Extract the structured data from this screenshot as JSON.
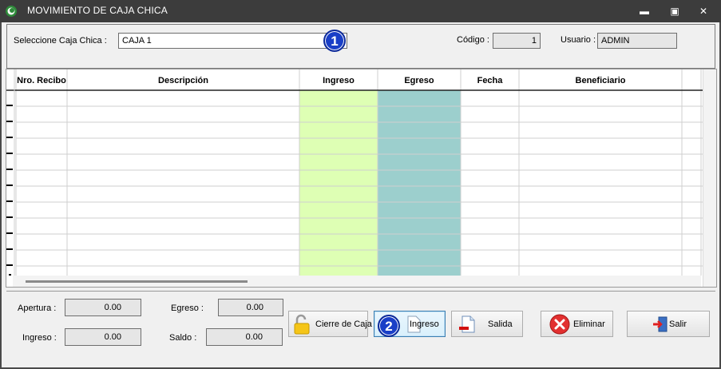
{
  "window": {
    "title": "MOVIMIENTO DE CAJA CHICA",
    "controls": {
      "minimize": "▬",
      "maximize": "▣",
      "close": "✕"
    }
  },
  "top": {
    "caja_label": "Seleccione Caja Chica :",
    "caja_value": "CAJA 1",
    "codigo_label": "Código :",
    "codigo_value": "1",
    "usuario_label": "Usuario :",
    "usuario_value": "ADMIN"
  },
  "grid": {
    "columns": [
      "Nro. Recibo",
      "Descripción",
      "Ingreso",
      "Egreso",
      "Fecha",
      "Beneficiario"
    ],
    "column_colors": {
      "Ingreso": "#deffb4",
      "Egreso": "#9ccfcd"
    },
    "rows": [
      [
        "",
        "",
        "",
        "",
        "",
        ""
      ],
      [
        "",
        "",
        "",
        "",
        "",
        ""
      ],
      [
        "",
        "",
        "",
        "",
        "",
        ""
      ],
      [
        "",
        "",
        "",
        "",
        "",
        ""
      ],
      [
        "",
        "",
        "",
        "",
        "",
        ""
      ],
      [
        "",
        "",
        "",
        "",
        "",
        ""
      ],
      [
        "",
        "",
        "",
        "",
        "",
        ""
      ],
      [
        "",
        "",
        "",
        "",
        "",
        ""
      ],
      [
        "",
        "",
        "",
        "",
        "",
        ""
      ],
      [
        "",
        "",
        "",
        "",
        "",
        ""
      ],
      [
        "",
        "",
        "",
        "",
        "",
        ""
      ]
    ]
  },
  "totals": {
    "apertura_label": "Apertura :",
    "apertura_value": "0.00",
    "ingreso_label": "Ingreso :",
    "ingreso_value": "0.00",
    "egreso_label": "Egreso :",
    "egreso_value": "0.00",
    "saldo_label": "Saldo :",
    "saldo_value": "0.00"
  },
  "buttons": {
    "cierre": "Cierre de Caja",
    "ingreso": "Ingreso",
    "salida": "Salida",
    "eliminar": "Eliminar",
    "salir": "Salir"
  },
  "callouts": {
    "one": "1",
    "two": "2"
  },
  "icons": {
    "app": "circle-app-icon",
    "cierre": "padlock-open-icon",
    "ingreso": "document-blank-icon",
    "salida": "document-minus-icon",
    "eliminar": "red-x-circle-icon",
    "salir": "exit-door-arrow-icon"
  }
}
